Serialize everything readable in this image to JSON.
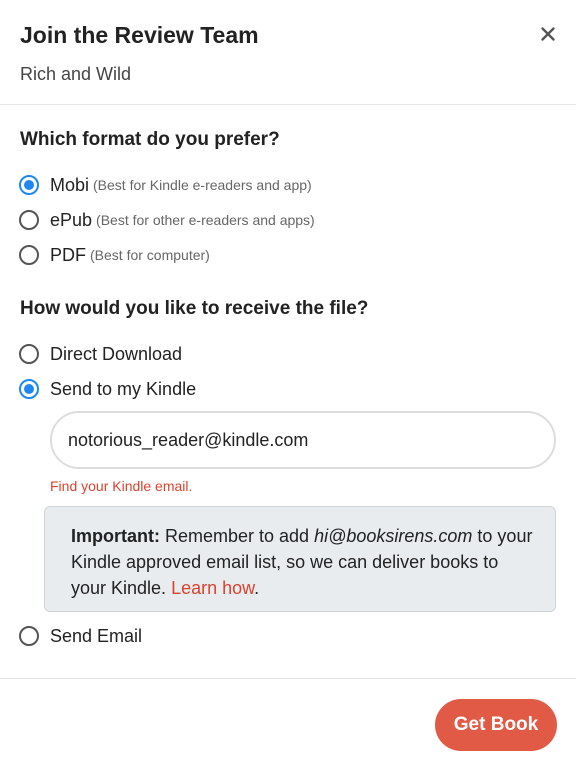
{
  "header": {
    "title": "Join the Review Team",
    "subtitle": "Rich and Wild",
    "close_icon": "close-icon"
  },
  "format": {
    "heading": "Which format do you prefer?",
    "options": [
      {
        "label": "Mobi",
        "hint": "(Best for Kindle e-readers and app)",
        "checked": true
      },
      {
        "label": "ePub",
        "hint": "(Best for other e-readers and apps)",
        "checked": false
      },
      {
        "label": "PDF",
        "hint": "(Best for computer)",
        "checked": false
      }
    ]
  },
  "delivery": {
    "heading": "How would you like to receive the file?",
    "options": [
      {
        "label": "Direct Download",
        "checked": false
      },
      {
        "label": "Send to my Kindle",
        "checked": true
      },
      {
        "label": "Send Email",
        "checked": false
      }
    ],
    "kindle_email_value": "notorious_reader@kindle.com",
    "find_email_link": "Find your Kindle email.",
    "notice": {
      "strong": "Important:",
      "text_before": " Remember to add ",
      "email": "hi@booksirens.com",
      "text_after": " to your Kindle approved email list, so we can deliver books to your Kindle. ",
      "link": "Learn how",
      "end": "."
    }
  },
  "footer": {
    "button_label": "Get Book"
  },
  "colors": {
    "accent_radio": "#1e88f0",
    "brand_button": "#e05a45",
    "link_red": "#d9432e"
  }
}
